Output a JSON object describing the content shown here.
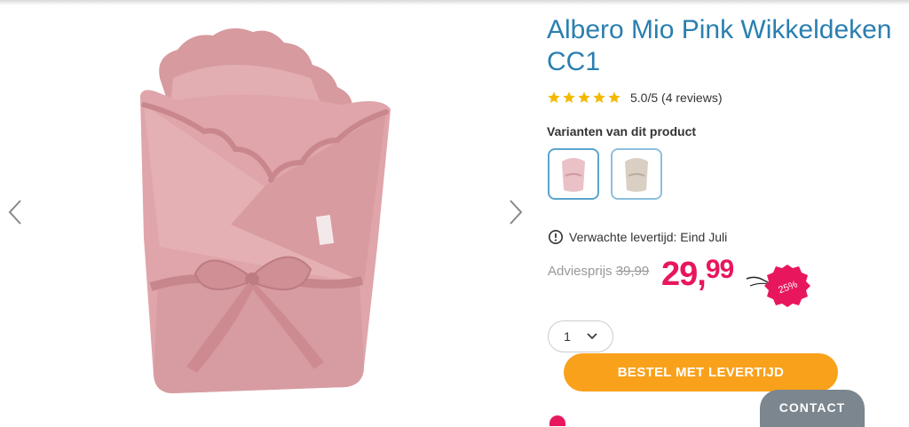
{
  "product": {
    "title": "Albero Mio Pink Wikkeldeken CC1",
    "rating": {
      "stars": 5,
      "text": "5.0/5 (4 reviews)"
    },
    "variants_label": "Varianten van dit product",
    "variants": [
      {
        "color": "#e9c1c6"
      },
      {
        "color": "#d9cfc2"
      }
    ],
    "delivery_text": "Verwachte levertijd: Eind Juli",
    "price": {
      "advice_label": "Adviesprijs",
      "advice_value": "39,99",
      "current_main": "29,",
      "current_cents": "99",
      "discount": "25%"
    },
    "quantity": "1",
    "order_button": "BESTEL MET LEVERTIJD"
  },
  "contact_button": "CONTACT",
  "colors": {
    "title": "#2a7fb0",
    "price": "#e8175d",
    "order_button": "#f9a11b",
    "stars": "#f5b800",
    "contact": "#7b868e"
  }
}
